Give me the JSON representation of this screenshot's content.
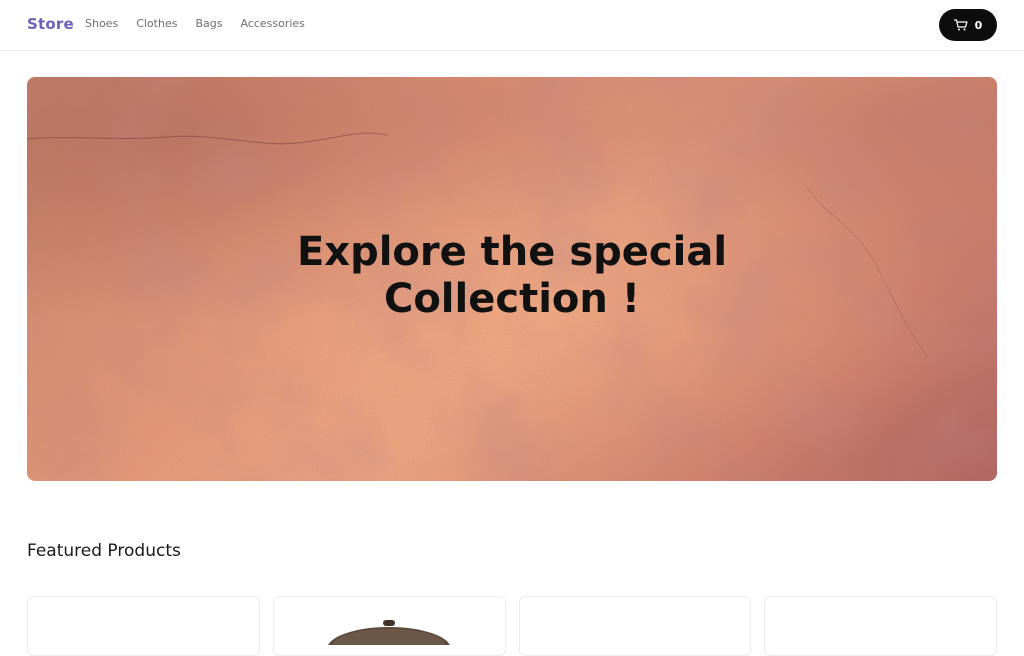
{
  "nav": {
    "brand": "Store",
    "links": [
      "Shoes",
      "Clothes",
      "Bags",
      "Accessories"
    ],
    "cart_count": "0",
    "cart_icon": "cart-icon"
  },
  "hero": {
    "title": "Explore the special\nCollection !"
  },
  "featured": {
    "heading": "Featured Products",
    "products": [
      {
        "image": "none"
      },
      {
        "image": "cap-image"
      },
      {
        "image": "none"
      },
      {
        "image": "none"
      }
    ]
  },
  "colors": {
    "brand": "#6a62b6",
    "cart_button": "#0d0d0d",
    "hero_base": "#e69a78"
  }
}
